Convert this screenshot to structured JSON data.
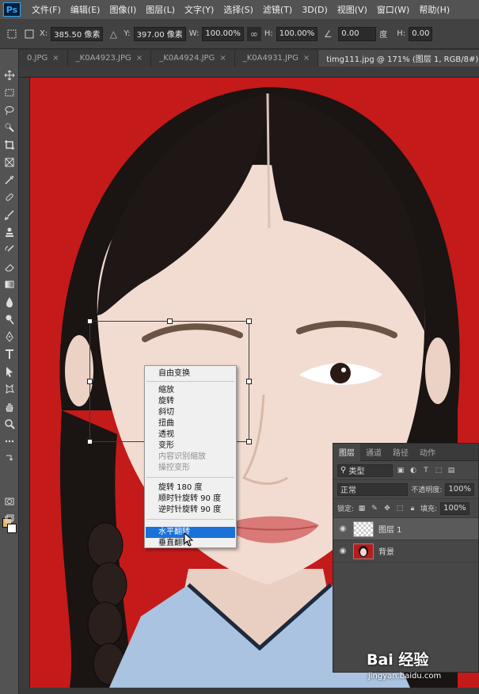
{
  "app": {
    "logo": "Ps"
  },
  "menubar": {
    "items": [
      "文件(F)",
      "编辑(E)",
      "图像(I)",
      "图层(L)",
      "文字(Y)",
      "选择(S)",
      "滤镜(T)",
      "3D(D)",
      "视图(V)",
      "窗口(W)",
      "帮助(H)"
    ]
  },
  "options": {
    "x_label": "X:",
    "x_value": "385.50 像素",
    "y_label": "Y:",
    "y_value": "397.00 像素",
    "w_label": "W:",
    "w_value": "100.00%",
    "h_label": "H:",
    "h_value": "100.00%",
    "angle_value": "0.00",
    "angle_unit": "度",
    "h2_label": "H:",
    "h2_value": "0.00"
  },
  "tabs": [
    {
      "label": "0.JPG"
    },
    {
      "label": "_K0A4923.JPG"
    },
    {
      "label": "_K0A4924.JPG"
    },
    {
      "label": "_K0A4931.JPG"
    },
    {
      "label": "timg111.jpg @ 171% (图层 1, RGB/8#) *",
      "active": true
    }
  ],
  "context_menu": {
    "items": [
      {
        "label": "自由变换"
      },
      {
        "label": "缩放"
      },
      {
        "label": "旋转"
      },
      {
        "label": "斜切"
      },
      {
        "label": "扭曲"
      },
      {
        "label": "透视"
      },
      {
        "label": "变形"
      },
      {
        "label": "内容识别缩放",
        "disabled": true
      },
      {
        "label": "操控变形",
        "disabled": true
      },
      {
        "label": "旋转 180 度"
      },
      {
        "label": "顺时针旋转 90 度"
      },
      {
        "label": "逆时针旋转 90 度"
      },
      {
        "label": "水平翻转",
        "selected": true
      },
      {
        "label": "垂直翻转"
      }
    ]
  },
  "layers_panel": {
    "tabs": [
      "图层",
      "通道",
      "路径",
      "动作"
    ],
    "filter_label": "类型",
    "blend_mode": "正常",
    "opacity_label": "不透明度:",
    "opacity_value": "100%",
    "lock_label": "锁定:",
    "fill_label": "填充:",
    "fill_value": "100%",
    "layers": [
      {
        "name": "图层 1",
        "selected": true
      },
      {
        "name": "背景"
      }
    ]
  },
  "watermark": {
    "brand": "Bai 经验",
    "url": "jingyan.baidu.com"
  },
  "colors": {
    "canvas_bg": "#c51a1a",
    "menu_selected": "#1a72d8",
    "foreground": "#e8b46a",
    "background": "#ffffff"
  },
  "icons": [
    "move-icon",
    "marquee-icon",
    "lasso-icon",
    "quick-select-icon",
    "crop-icon",
    "frame-icon",
    "eyedropper-icon",
    "healing-icon",
    "brush-icon",
    "stamp-icon",
    "history-brush-icon",
    "eraser-icon",
    "gradient-icon",
    "blur-icon",
    "dodge-icon",
    "pen-icon",
    "type-icon",
    "path-select-icon",
    "shape-icon",
    "hand-icon",
    "zoom-icon",
    "quick-mask-icon",
    "screen-mode-icon"
  ]
}
